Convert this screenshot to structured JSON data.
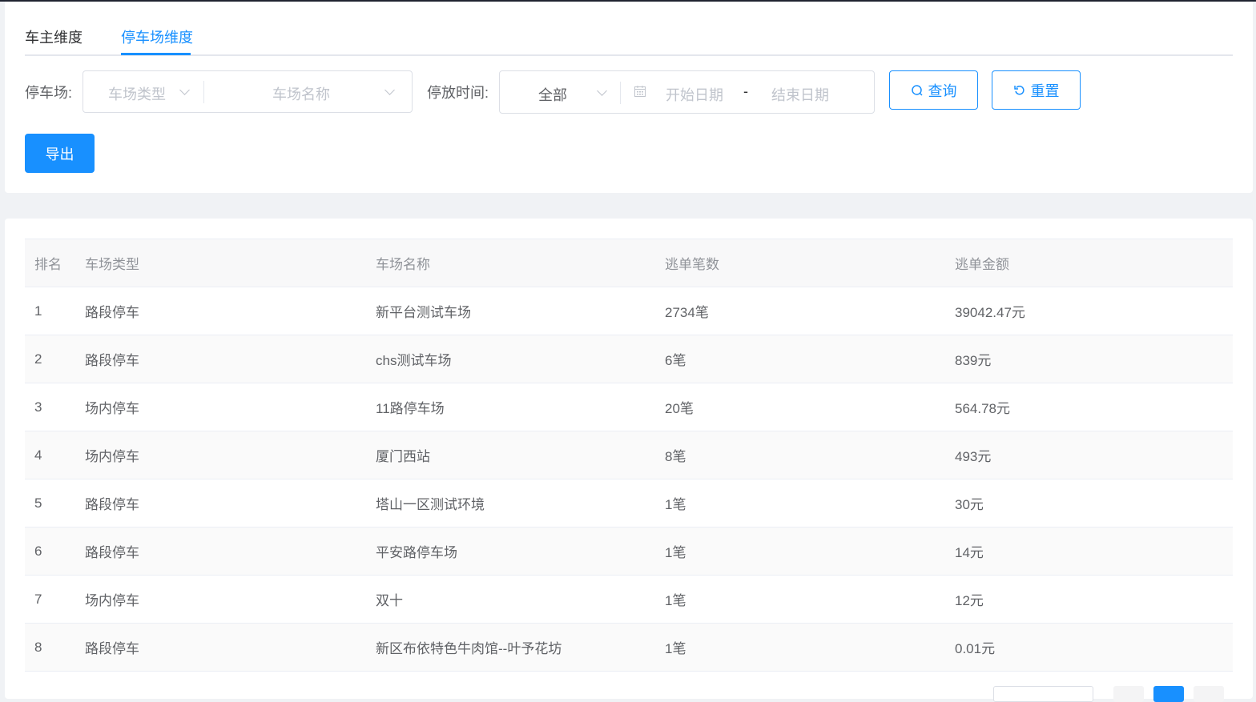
{
  "tabs": [
    {
      "label": "车主维度",
      "active": false
    },
    {
      "label": "停车场维度",
      "active": true
    }
  ],
  "filters": {
    "parking_label": "停车场:",
    "lot_type_placeholder": "车场类型",
    "lot_name_placeholder": "车场名称",
    "time_label": "停放时间:",
    "time_range_value": "全部",
    "start_date_placeholder": "开始日期",
    "date_separator": "-",
    "end_date_placeholder": "结束日期",
    "query_label": "查询",
    "reset_label": "重置",
    "export_label": "导出"
  },
  "table": {
    "columns": [
      "排名",
      "车场类型",
      "车场名称",
      "逃单笔数",
      "逃单金额"
    ],
    "rows": [
      [
        "1",
        "路段停车",
        "新平台测试车场",
        "2734笔",
        "39042.47元"
      ],
      [
        "2",
        "路段停车",
        "chs测试车场",
        "6笔",
        "839元"
      ],
      [
        "3",
        "场内停车",
        "11路停车场",
        "20笔",
        "564.78元"
      ],
      [
        "4",
        "场内停车",
        "厦门西站",
        "8笔",
        "493元"
      ],
      [
        "5",
        "路段停车",
        "塔山一区测试环境",
        "1笔",
        "30元"
      ],
      [
        "6",
        "路段停车",
        "平安路停车场",
        "1笔",
        "14元"
      ],
      [
        "7",
        "场内停车",
        "双十",
        "1笔",
        "12元"
      ],
      [
        "8",
        "路段停车",
        "新区布依特色牛肉馆--叶予花坊",
        "1笔",
        "0.01元"
      ]
    ]
  },
  "colors": {
    "accent": "#1890ff"
  }
}
